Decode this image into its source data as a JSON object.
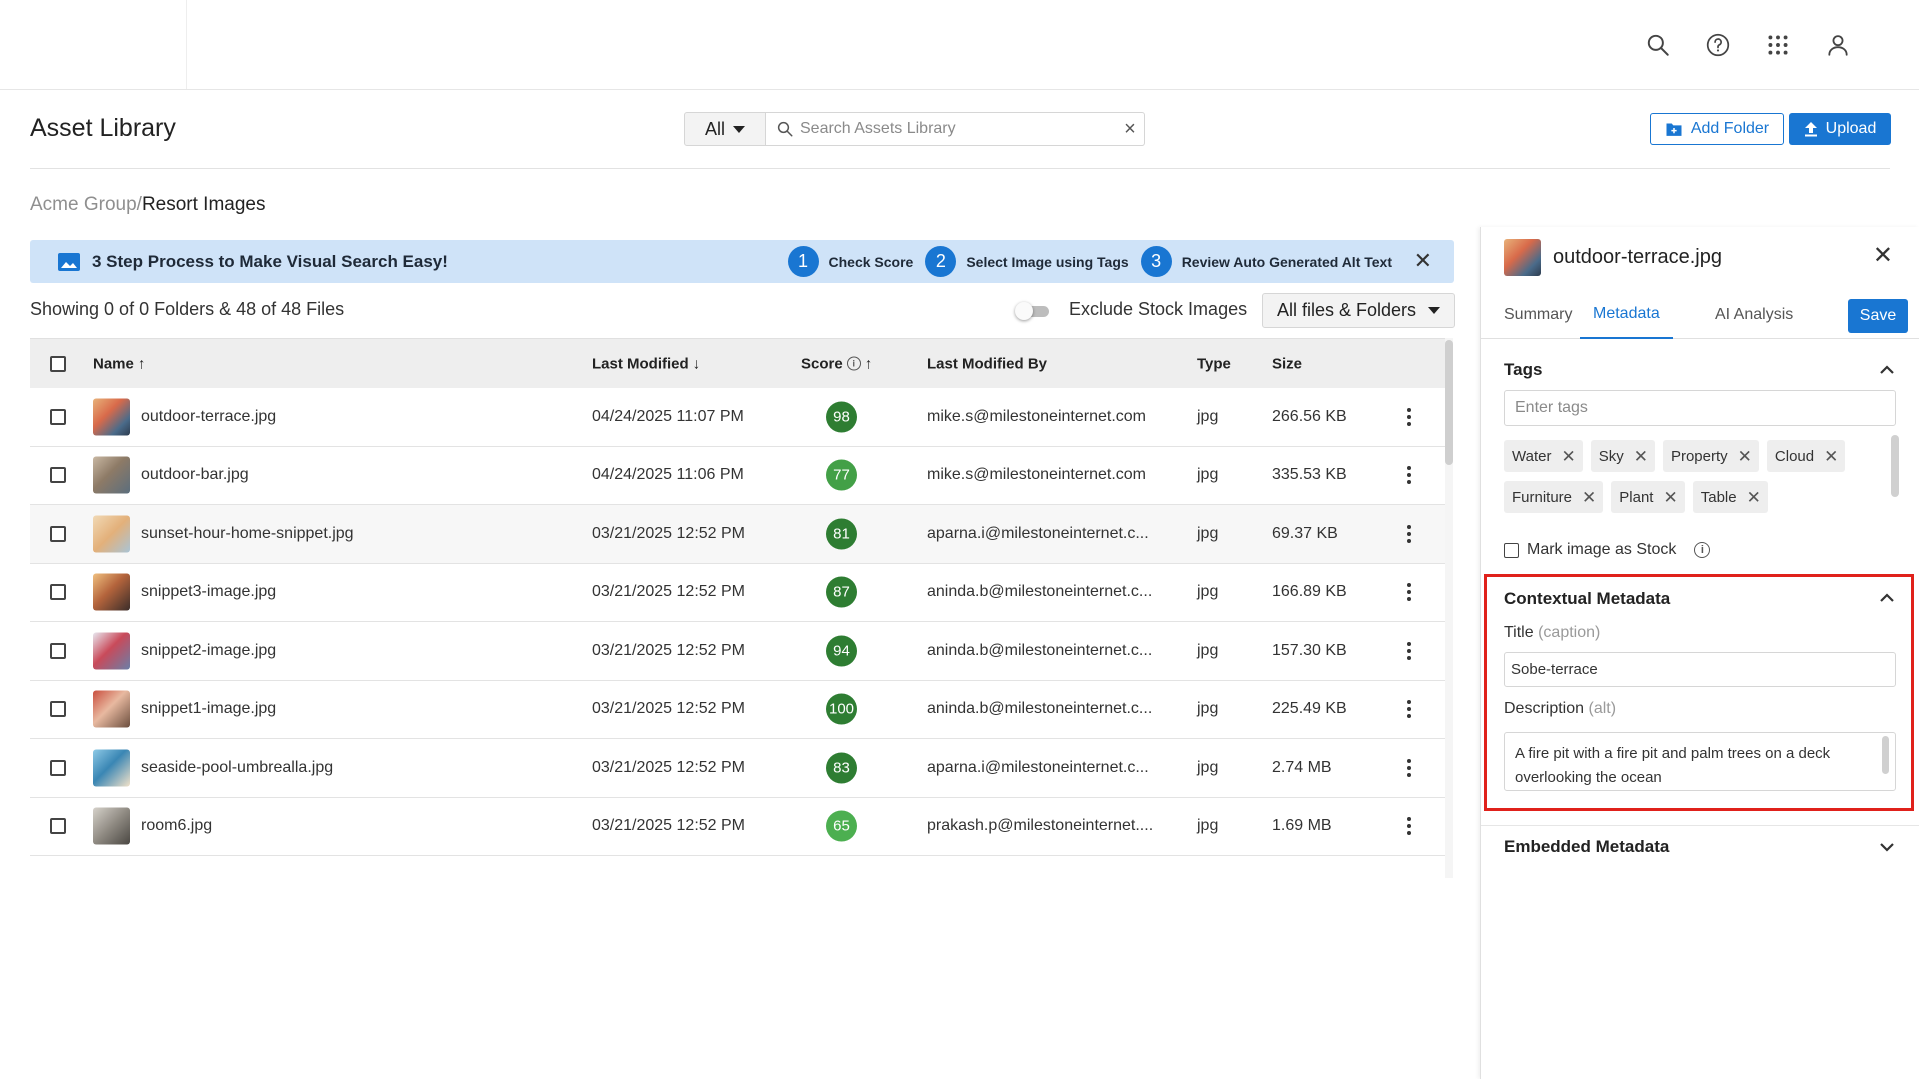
{
  "colors": {
    "accent": "#1976d2",
    "banner_bg": "#cfe3f8",
    "highlight": "#e0211b",
    "score_dark": "#2e7d32",
    "score_mid": "#43a047",
    "score_light": "#4caf50"
  },
  "topbar": {
    "icons": [
      "search-icon",
      "help-icon",
      "apps-grid-icon",
      "account-icon"
    ]
  },
  "header": {
    "title": "Asset Library",
    "filter_value": "All",
    "search_placeholder": "Search Assets Library",
    "add_folder_label": "Add Folder",
    "upload_label": "Upload"
  },
  "breadcrumb": {
    "root": "Acme Group/",
    "current": "Resort Images"
  },
  "banner": {
    "title": "3 Step Process to Make Visual Search Easy!",
    "steps": [
      {
        "num": "1",
        "label": "Check Score"
      },
      {
        "num": "2",
        "label": "Select Image using Tags"
      },
      {
        "num": "3",
        "label": "Review Auto Generated Alt Text"
      }
    ]
  },
  "listing": {
    "showing": "Showing 0 of 0 Folders & 48 of 48 Files",
    "exclude_stock_label": "Exclude Stock Images",
    "exclude_stock_on": false,
    "files_filter": "All files & Folders"
  },
  "table": {
    "columns": {
      "name": "Name",
      "modified": "Last Modified",
      "score": "Score",
      "modified_by": "Last Modified By",
      "type": "Type",
      "size": "Size"
    },
    "rows": [
      {
        "name": "outdoor-terrace.jpg",
        "modified": "04/24/2025 11:07 PM",
        "score": "98",
        "by": "mike.s@milestoneinternet.com",
        "type": "jpg",
        "size": "266.56 KB"
      },
      {
        "name": "outdoor-bar.jpg",
        "modified": "04/24/2025 11:06 PM",
        "score": "77",
        "by": "mike.s@milestoneinternet.com",
        "type": "jpg",
        "size": "335.53 KB"
      },
      {
        "name": "sunset-hour-home-snippet.jpg",
        "modified": "03/21/2025 12:52 PM",
        "score": "81",
        "by": "aparna.i@milestoneinternet.c...",
        "type": "jpg",
        "size": "69.37 KB"
      },
      {
        "name": "snippet3-image.jpg",
        "modified": "03/21/2025 12:52 PM",
        "score": "87",
        "by": "aninda.b@milestoneinternet.c...",
        "type": "jpg",
        "size": "166.89 KB"
      },
      {
        "name": "snippet2-image.jpg",
        "modified": "03/21/2025 12:52 PM",
        "score": "94",
        "by": "aninda.b@milestoneinternet.c...",
        "type": "jpg",
        "size": "157.30 KB"
      },
      {
        "name": "snippet1-image.jpg",
        "modified": "03/21/2025 12:52 PM",
        "score": "100",
        "by": "aninda.b@milestoneinternet.c...",
        "type": "jpg",
        "size": "225.49 KB"
      },
      {
        "name": "seaside-pool-umbrealla.jpg",
        "modified": "03/21/2025 12:52 PM",
        "score": "83",
        "by": "aparna.i@milestoneinternet.c...",
        "type": "jpg",
        "size": "2.74 MB"
      },
      {
        "name": "room6.jpg",
        "modified": "03/21/2025 12:52 PM",
        "score": "65",
        "by": "prakash.p@milestoneinternet....",
        "type": "jpg",
        "size": "1.69 MB"
      }
    ]
  },
  "panel": {
    "file_name": "outdoor-terrace.jpg",
    "tabs": [
      "Summary",
      "Metadata",
      "AI Analysis"
    ],
    "active_tab": "Metadata",
    "save_label": "Save",
    "tags_heading": "Tags",
    "tags_placeholder": "Enter tags",
    "tags": [
      "Water",
      "Sky",
      "Property",
      "Cloud",
      "Furniture",
      "Plant",
      "Table"
    ],
    "stock_label": "Mark image as Stock",
    "contextual_heading": "Contextual Metadata",
    "title_label": "Title",
    "title_hint": "(caption)",
    "title_value": "Sobe-terrace",
    "description_label": "Description",
    "description_hint": "(alt)",
    "description_value": "A fire pit with a fire pit and palm trees on a deck overlooking the ocean",
    "embedded_heading": "Embedded Metadata"
  }
}
